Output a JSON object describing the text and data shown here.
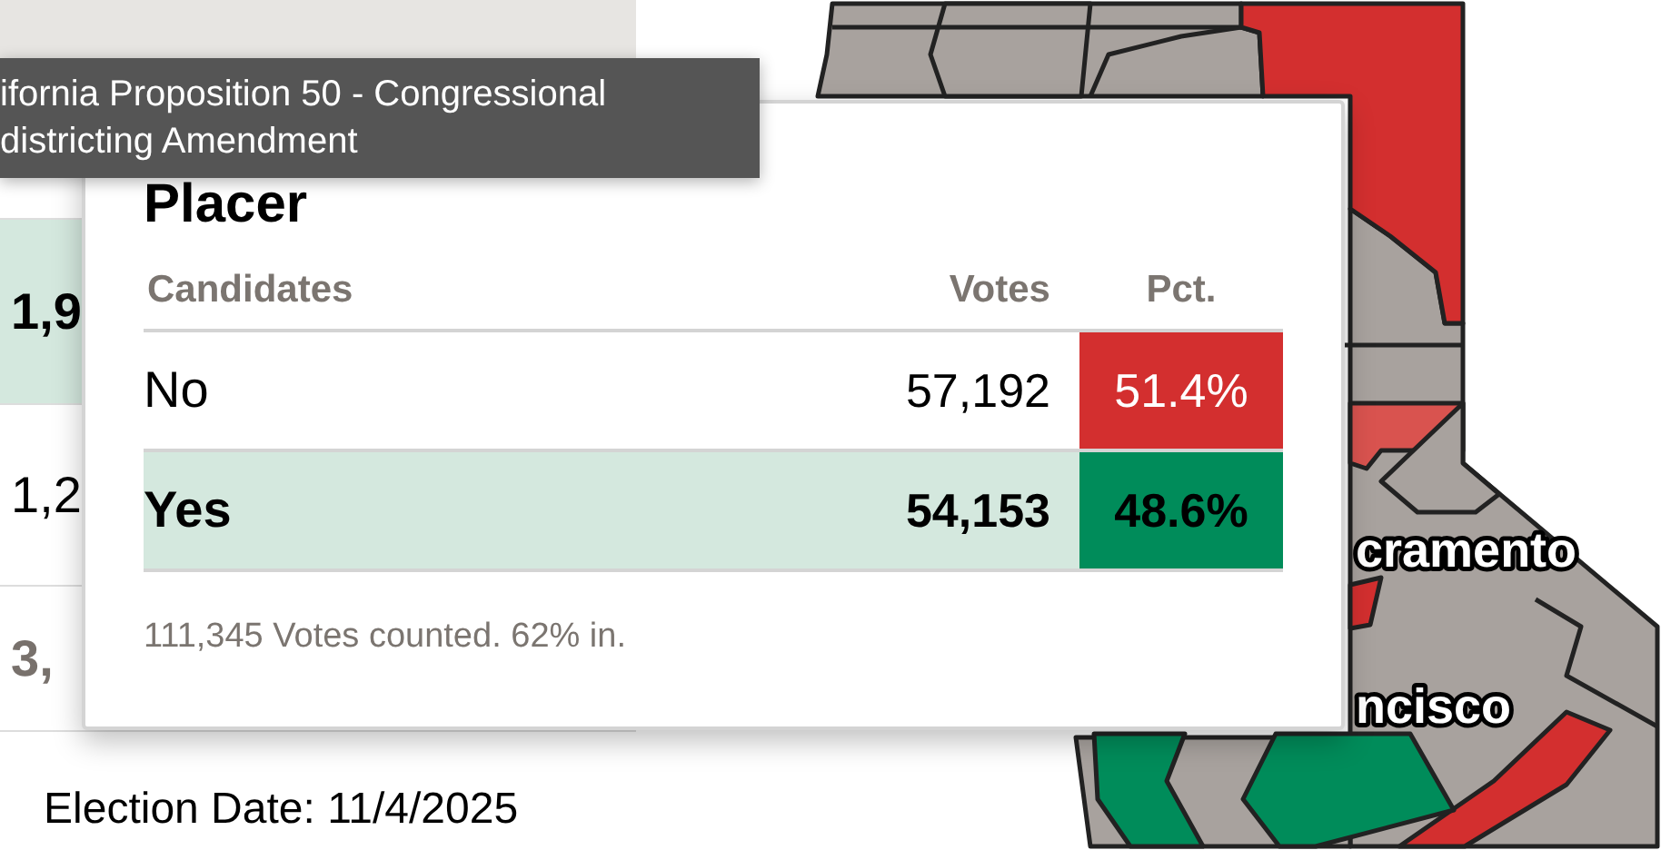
{
  "tooltip": {
    "lines": [
      "ifornia Proposition 50 - Congressional",
      "districting Amendment"
    ]
  },
  "results_table": {
    "rows": [
      {
        "value": "1,9",
        "kind": "leader"
      },
      {
        "value": "1,2",
        "kind": "other"
      },
      {
        "value": "3,",
        "kind": "total"
      }
    ]
  },
  "popup": {
    "title": "Placer",
    "columns": [
      "Candidates",
      "Votes",
      "Pct."
    ],
    "rows": [
      {
        "name": "No",
        "votes": "57,192",
        "pct": "51.4%",
        "color": "#d32f2f",
        "leading": false
      },
      {
        "name": "Yes",
        "votes": "54,153",
        "pct": "48.6%",
        "color": "#008c5a",
        "leading": true
      }
    ],
    "footer": "111,345 Votes counted. 62% in."
  },
  "map": {
    "labels": [
      "cramento",
      "ncisco"
    ]
  },
  "election_date": "Election Date: 11/4/2025"
}
